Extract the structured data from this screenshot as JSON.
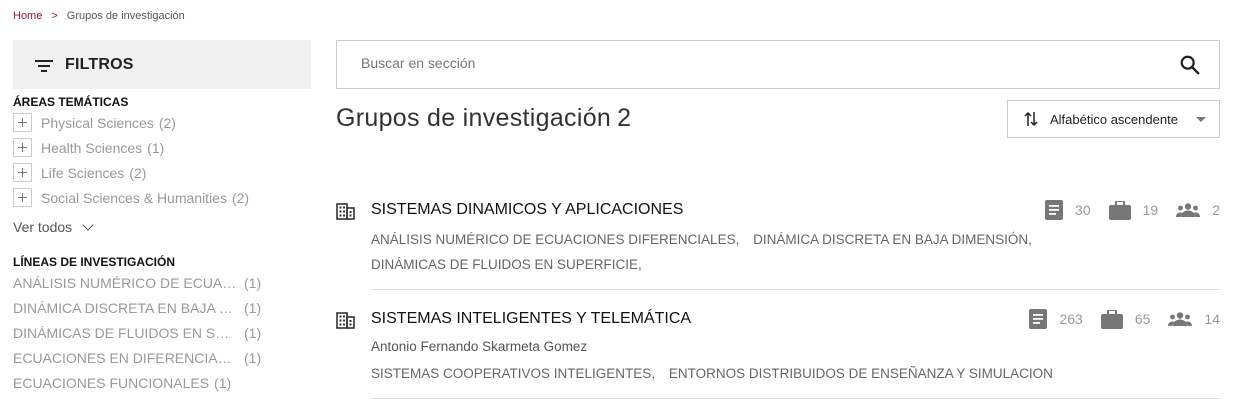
{
  "breadcrumb": {
    "home": "Home",
    "separator": ">",
    "current": "Grupos de investigación"
  },
  "filters": {
    "header_label": "FILTROS",
    "areas_title": "ÁREAS TEMÁTICAS",
    "areas": [
      {
        "label": "Physical Sciences",
        "count": "(2)"
      },
      {
        "label": "Health Sciences",
        "count": "(1)"
      },
      {
        "label": "Life Sciences",
        "count": "(2)"
      },
      {
        "label": "Social Sciences & Humanities",
        "count": "(2)"
      }
    ],
    "see_all": "Ver todos",
    "lines_title": "LÍNEAS DE INVESTIGACIÓN",
    "lines": [
      {
        "label": "ANÁLISIS NUMÉRICO DE ECUACIONES DIFERENCIALES",
        "count": "(1)"
      },
      {
        "label": "DINÁMICA DISCRETA EN BAJA DIMENSIÓN",
        "count": "(1)"
      },
      {
        "label": "DINÁMICAS DE FLUIDOS EN SUPERFICIE",
        "count": "(1)"
      },
      {
        "label": "ECUACIONES EN DIFERENCIAS NO LINEALES",
        "count": "(1)"
      },
      {
        "label": "ECUACIONES FUNCIONALES",
        "count": "(1)"
      }
    ]
  },
  "search": {
    "placeholder": "Buscar en sección"
  },
  "main": {
    "title": "Grupos de investigación",
    "count": "2"
  },
  "sort": {
    "label": "Alfabético ascendente"
  },
  "groups": [
    {
      "title": "SISTEMAS DINAMICOS Y APLICACIONES",
      "stats": {
        "documents": "30",
        "projects": "19",
        "members": "2"
      },
      "lines": [
        "ANÁLISIS NUMÉRICO DE ECUACIONES DIFERENCIALES,",
        "DINÁMICA DISCRETA EN BAJA DIMENSIÓN,",
        "DINÁMICAS DE FLUIDOS EN SUPERFICIE,"
      ]
    },
    {
      "title": "SISTEMAS INTELIGENTES Y TELEMÁTICA",
      "stats": {
        "documents": "263",
        "projects": "65",
        "members": "14"
      },
      "leader": "Antonio Fernando Skarmeta Gomez",
      "lines": [
        "SISTEMAS COOPERATIVOS INTELIGENTES,",
        "ENTORNOS DISTRIBUIDOS DE ENSEÑANZA Y SIMULACION"
      ]
    }
  ],
  "colors": {
    "accent": "#8b1b3a",
    "muted_text": "#999999",
    "filter_bg": "#f1f1f1"
  },
  "icons": [
    "filter-icon",
    "plus-icon",
    "chevron-down-icon",
    "search-icon",
    "sort-icon",
    "building-icon",
    "document-icon",
    "briefcase-icon",
    "people-icon"
  ]
}
